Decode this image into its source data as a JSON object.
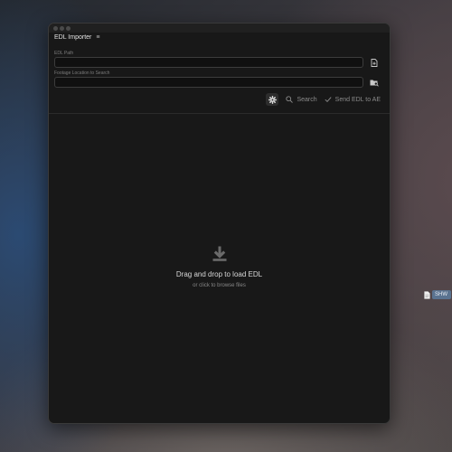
{
  "panel": {
    "title": "EDL Importer"
  },
  "fields": {
    "edl_path_label": "EDL Path",
    "edl_path_value": "",
    "footage_label": "Footage Location to Search",
    "footage_value": ""
  },
  "toolbar": {
    "search_label": "Search",
    "send_label": "Send EDL to AE"
  },
  "dropzone": {
    "title": "Drag and drop to load EDL",
    "subtitle": "or click to browse files"
  },
  "desktop": {
    "file_label": "SHW"
  },
  "icons": {
    "menu": "hamburger-icon",
    "file": "file-add-icon",
    "folder": "folder-search-icon",
    "settings": "gear-icon",
    "search": "search-icon",
    "send": "checkmark-icon",
    "drop": "download-icon"
  }
}
